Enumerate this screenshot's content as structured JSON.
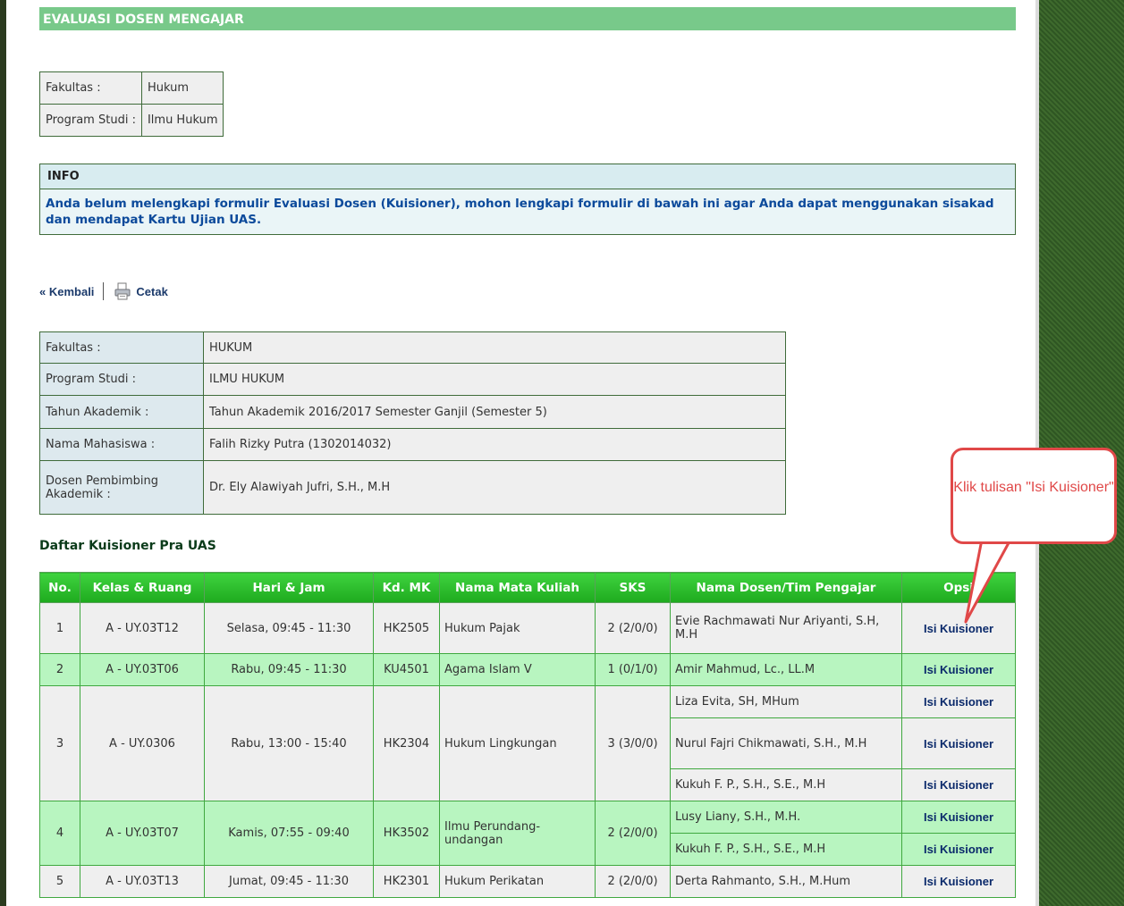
{
  "header": {
    "title": "EVALUASI DOSEN MENGAJAR"
  },
  "info_table": {
    "fakultas_label": "Fakultas :",
    "fakultas_value": "Hukum",
    "prodi_label": "Program Studi :",
    "prodi_value": "Ilmu Hukum"
  },
  "info_box": {
    "title": "INFO",
    "message": "Anda belum melengkapi formulir Evaluasi Dosen (Kuisioner), mohon lengkapi formulir di bawah ini agar Anda dapat menggunakan sisakad dan mendapat Kartu Ujian UAS."
  },
  "nav": {
    "back_label": "« Kembali",
    "print_label": "Cetak",
    "print_icon": "printer-icon"
  },
  "details": {
    "fakultas_label": "Fakultas :",
    "fakultas_value": "HUKUM",
    "prodi_label": "Program Studi :",
    "prodi_value": "ILMU HUKUM",
    "tahun_label": "Tahun Akademik :",
    "tahun_value": "Tahun Akademik 2016/2017 Semester Ganjil (Semester 5)",
    "nama_label": "Nama Mahasiswa :",
    "nama_value": "Falih Rizky Putra (1302014032)",
    "dosen_label": "Dosen Pembimbing Akademik :",
    "dosen_value": "Dr. Ely Alawiyah Jufri, S.H., M.H"
  },
  "list": {
    "title": "Daftar Kuisioner Pra UAS",
    "headers": [
      "No.",
      "Kelas & Ruang",
      "Hari & Jam",
      "Kd. MK",
      "Nama Mata Kuliah",
      "SKS",
      "Nama Dosen/Tim Pengajar",
      "Opsi"
    ],
    "action_label": "Isi Kuisioner",
    "rows": [
      {
        "no": "1",
        "kelas": "A - UY.03T12",
        "hari": "Selasa, 09:45 - 11:30",
        "kd": "HK2505",
        "mk": "Hukum Pajak",
        "sks": "2 (2/0/0)",
        "dosen": [
          "Evie Rachmawati Nur Ariyanti, S.H, M.H"
        ]
      },
      {
        "no": "2",
        "kelas": "A - UY.03T06",
        "hari": "Rabu, 09:45 - 11:30",
        "kd": "KU4501",
        "mk": "Agama Islam V",
        "sks": "1 (0/1/0)",
        "dosen": [
          "Amir Mahmud, Lc., LL.M"
        ]
      },
      {
        "no": "3",
        "kelas": "A - UY.0306",
        "hari": "Rabu, 13:00 - 15:40",
        "kd": "HK2304",
        "mk": "Hukum Lingkungan",
        "sks": "3 (3/0/0)",
        "dosen": [
          "Liza Evita, SH, MHum",
          "Nurul Fajri Chikmawati, S.H., M.H",
          "Kukuh F. P., S.H., S.E., M.H"
        ]
      },
      {
        "no": "4",
        "kelas": "A - UY.03T07",
        "hari": "Kamis, 07:55 - 09:40",
        "kd": "HK3502",
        "mk": "Ilmu Perundang-undangan",
        "sks": "2 (2/0/0)",
        "dosen": [
          "Lusy Liany, S.H., M.H.",
          "Kukuh F. P., S.H., S.E., M.H"
        ]
      },
      {
        "no": "5",
        "kelas": "A - UY.03T13",
        "hari": "Jumat, 09:45 - 11:30",
        "kd": "HK2301",
        "mk": "Hukum Perikatan",
        "sks": "2 (2/0/0)",
        "dosen": [
          "Derta Rahmanto, S.H., M.Hum"
        ]
      }
    ]
  },
  "callout": {
    "text": "Klik tulisan \"Isi Kuisioner\"",
    "color": "#e04848"
  }
}
